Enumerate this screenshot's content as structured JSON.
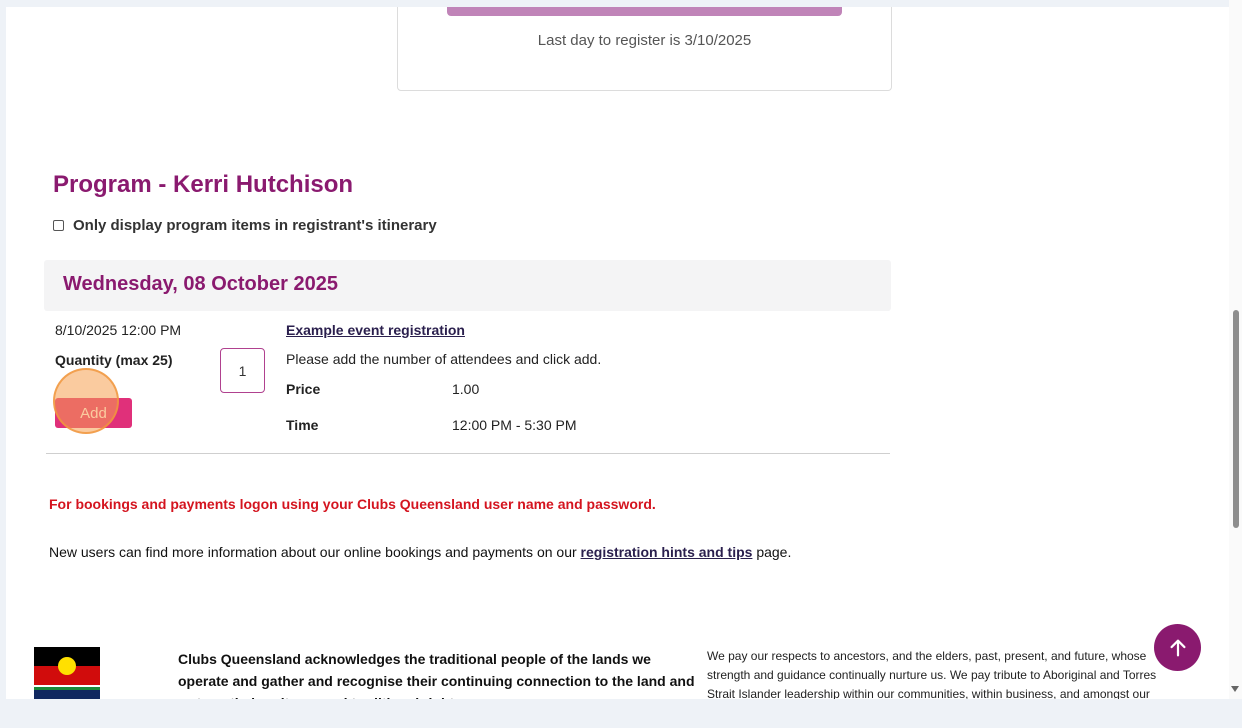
{
  "registration": {
    "last_day_note": "Last day to register is 3/10/2025"
  },
  "program": {
    "title": "Program - Kerri Hutchison",
    "filter_label": "Only display program items in registrant's itinerary",
    "filter_checked": false
  },
  "day": {
    "heading": "Wednesday, 08 October 2025"
  },
  "event": {
    "datetime": "8/10/2025 12:00 PM",
    "quantity_label": "Quantity (max 25)",
    "quantity_value": "1",
    "add_label": "Add",
    "title": "Example event registration",
    "description": "Please add the number of attendees and click add.",
    "price_label": "Price",
    "price_value": "1.00",
    "time_label": "Time",
    "time_value": "12:00 PM - 5:30 PM"
  },
  "notices": {
    "logon": "For bookings and payments logon using your Clubs Queensland user name and password.",
    "newusers_prefix": "New users can find more information about our online bookings and payments on our ",
    "newusers_link": "registration hints and tips",
    "newusers_suffix": " page."
  },
  "footer": {
    "acknowledgement": "Clubs Queensland acknowledges the traditional people of the lands we operate and gather and recognise their continuing connection to the land and waters, their cultures and traditional rights.",
    "respects": "We pay our respects to ancestors, and the elders, past, present, and future, whose strength and guidance continually nurture us. We pay tribute to Aboriginal and Torres Strait Islander leadership within our communities, within business, and amongst our"
  },
  "colors": {
    "brand_purple": "#8a1a6f",
    "add_button": "#e0307a",
    "notice_red": "#d4141f"
  },
  "icons": {
    "scroll_top": "arrow-up-icon"
  }
}
